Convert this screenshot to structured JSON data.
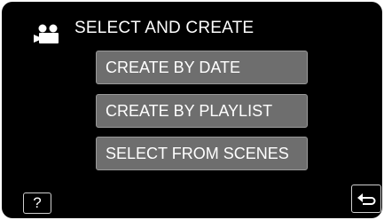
{
  "header": {
    "icon": "video-camera-icon",
    "title": "SELECT AND CREATE"
  },
  "menu": {
    "items": [
      {
        "label": "CREATE BY DATE"
      },
      {
        "label": "CREATE BY PLAYLIST"
      },
      {
        "label": "SELECT FROM SCENES"
      }
    ]
  },
  "footer": {
    "help_label": "?",
    "back_icon": "return-arrow-icon"
  },
  "colors": {
    "background": "#000000",
    "button_fill": "#6e6e6e",
    "button_border": "#9a9a9a",
    "text": "#ffffff"
  }
}
